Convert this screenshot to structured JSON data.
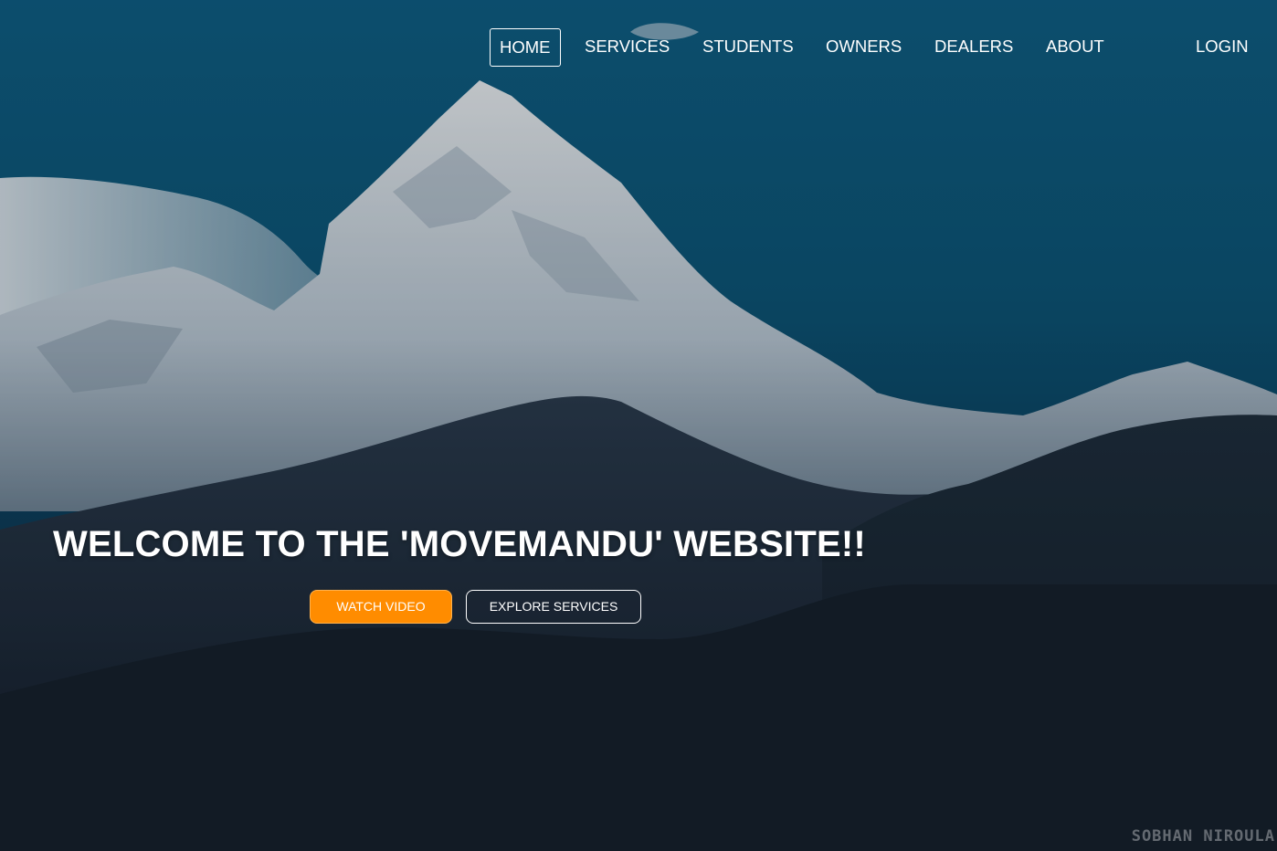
{
  "nav": {
    "items": [
      {
        "label": "HOME",
        "active": true
      },
      {
        "label": "SERVICES",
        "active": false
      },
      {
        "label": "STUDENTS",
        "active": false
      },
      {
        "label": "OWNERS",
        "active": false
      },
      {
        "label": "DEALERS",
        "active": false
      },
      {
        "label": "ABOUT",
        "active": false
      }
    ],
    "login_label": "LOGIN"
  },
  "hero": {
    "headline": "WELCOME TO THE 'MOVEMANDU' WEBSITE!!",
    "primary_button": "WATCH VIDEO",
    "secondary_button": "EXPLORE SERVICES",
    "watermark": "SOBHAN NIROULA"
  },
  "colors": {
    "accent": "#ff8c00",
    "sky": "#0f5f85",
    "text": "#ffffff"
  }
}
